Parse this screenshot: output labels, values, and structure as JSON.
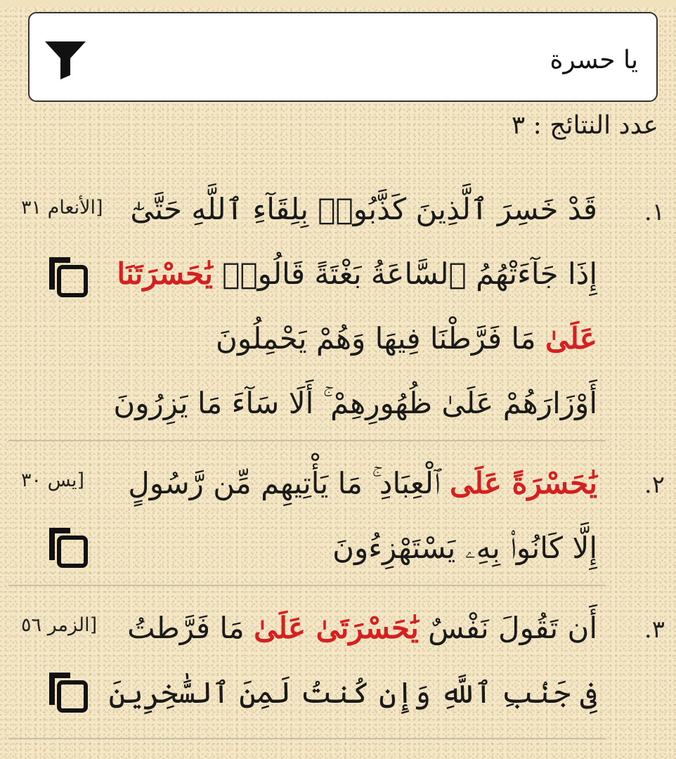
{
  "search": {
    "value": "يا حسرة"
  },
  "count_text": "عدد النتائج : ٣",
  "results": [
    {
      "number": "١.",
      "reference": "[الأنعام ٣١",
      "lines": [
        [
          {
            "t": "قَدْ خَسِرَ ٱلَّذِينَ كَذَّبُوا۟ بِلِقَآءِ ٱللَّهِ حَتَّىٰٓ"
          }
        ],
        [
          {
            "t": "إِذَا جَآءَتْهُمُ ٱلسَّاعَةُ بَغْتَةً قَالُوا۟ "
          },
          {
            "t": "يَٰحَسْرَتَنَا",
            "hl": true
          }
        ],
        [
          {
            "t": "عَلَىٰ",
            "hl": true
          },
          {
            "t": " مَا فَرَّطْنَا فِيهَا وَهُمْ يَحْمِلُونَ"
          }
        ],
        [
          {
            "t": "أَوْزَارَهُمْ عَلَىٰ ظُهُورِهِمْ ۚ أَلَا سَآءَ مَا يَزِرُونَ"
          }
        ]
      ]
    },
    {
      "number": "٢.",
      "reference": "[يس ٣٠",
      "lines": [
        [
          {
            "t": "يَٰحَسْرَةً عَلَى",
            "hl": true
          },
          {
            "t": " ٱلْعِبَادِ ۚ مَا يَأْتِيهِم مِّن رَّسُولٍ"
          }
        ],
        [
          {
            "t": "إِلَّا كَانُوا۟ بِهِۦ يَسْتَهْزِءُونَ"
          }
        ]
      ]
    },
    {
      "number": "٣.",
      "reference": "[الزمر ٥٦",
      "lines": [
        [
          {
            "t": "أَن تَقُولَ نَفْسٌ "
          },
          {
            "t": "يَٰحَسْرَتَىٰ عَلَىٰ",
            "hl": true
          },
          {
            "t": " مَا فَرَّطتُ"
          }
        ],
        [
          {
            "t": "فِى جَنۢبِ ٱللَّهِ وَإِن كُنتُ لَمِنَ ٱلسَّٰخِرِينَ"
          }
        ]
      ]
    }
  ]
}
